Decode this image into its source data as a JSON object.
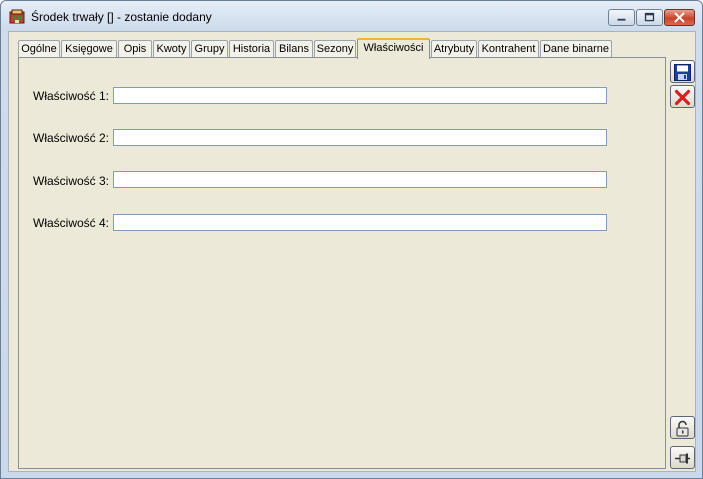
{
  "window": {
    "title": "Środek trwały [] - zostanie dodany",
    "icons": {
      "app": "fixed-asset-icon",
      "minimize": "minimize-icon",
      "maximize": "maximize-icon",
      "close": "close-icon"
    }
  },
  "tabs": [
    {
      "label": "Ogólne",
      "active": false
    },
    {
      "label": "Księgowe",
      "active": false
    },
    {
      "label": "Opis",
      "active": false
    },
    {
      "label": "Kwoty",
      "active": false
    },
    {
      "label": "Grupy",
      "active": false
    },
    {
      "label": "Historia",
      "active": false
    },
    {
      "label": "Bilans",
      "active": false
    },
    {
      "label": "Sezony",
      "active": false
    },
    {
      "label": "Właściwości",
      "active": true
    },
    {
      "label": "Atrybuty",
      "active": false
    },
    {
      "label": "Kontrahent",
      "active": false
    },
    {
      "label": "Dane binarne",
      "active": false
    }
  ],
  "properties": [
    {
      "label": "Właściwość 1:",
      "value": ""
    },
    {
      "label": "Właściwość 2:",
      "value": ""
    },
    {
      "label": "Właściwość 3:",
      "value": ""
    },
    {
      "label": "Właściwość 4:",
      "value": ""
    }
  ],
  "side_buttons": {
    "save": "save-icon",
    "cancel": "cancel-icon",
    "lock": "lock-icon",
    "pin": "pin-icon"
  },
  "colors": {
    "active_tab_accent": "#f5b038",
    "cancel_red": "#d81e1e",
    "save_blue": "#1c3f9c"
  }
}
